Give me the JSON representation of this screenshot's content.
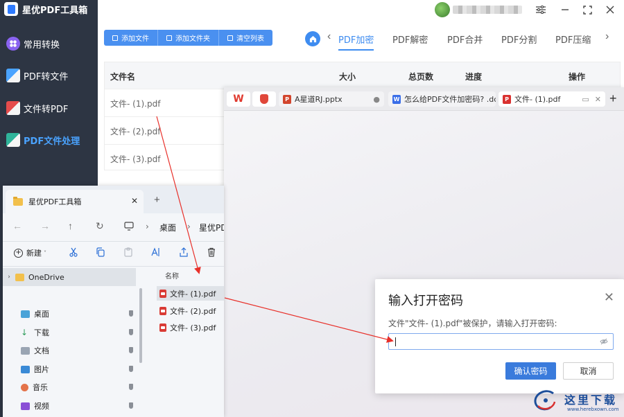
{
  "app": {
    "title": "星优PDF工具箱",
    "nav": [
      {
        "label": "常用转换"
      },
      {
        "label": "PDF转文件"
      },
      {
        "label": "文件转PDF"
      },
      {
        "label": "PDF文件处理"
      }
    ],
    "toolbar": {
      "add_file": "添加文件",
      "add_folder": "添加文件夹",
      "clear_list": "清空列表"
    },
    "func_tabs": [
      "PDF加密",
      "PDF解密",
      "PDF合并",
      "PDF分割",
      "PDF压缩"
    ],
    "table": {
      "headers": [
        "文件名",
        "大小",
        "总页数",
        "进度",
        "操作"
      ],
      "rows": [
        "文件- (1).pdf",
        "文件- (2).pdf",
        "文件- (3).pdf"
      ]
    }
  },
  "wps": {
    "tabs": [
      {
        "label": "A星道RJ.pptx",
        "icon": "ppt-file-icon"
      },
      {
        "label": "怎么给PDF文件加密码? .dc",
        "icon": "word-file-icon"
      },
      {
        "label": "文件- (1).pdf",
        "icon": "pdf-file-icon"
      }
    ]
  },
  "dialog": {
    "title": "输入打开密码",
    "message": "文件\"文件- (1).pdf\"被保护，请输入打开密码:",
    "confirm": "确认密码",
    "cancel": "取消",
    "password_value": ""
  },
  "explorer": {
    "tab_title": "星优PDF工具箱",
    "breadcrumb": [
      "桌面",
      "星优PD"
    ],
    "new_label": "新建",
    "tree": [
      {
        "label": "OneDrive",
        "icon": "folder-icon"
      },
      {
        "label": "桌面",
        "icon": "desktop-icon"
      },
      {
        "label": "下载",
        "icon": "download-icon"
      },
      {
        "label": "文档",
        "icon": "document-icon"
      },
      {
        "label": "图片",
        "icon": "picture-icon"
      },
      {
        "label": "音乐",
        "icon": "music-icon"
      },
      {
        "label": "视频",
        "icon": "video-icon"
      }
    ],
    "column_name": "名称",
    "files": [
      "文件- (1).pdf",
      "文件- (2).pdf",
      "文件- (3).pdf"
    ]
  },
  "watermark": {
    "text": "这里下载",
    "url": "www.herebxown.com"
  },
  "colors": {
    "sidebar_bg": "#2d3543",
    "accent_blue": "#3e8cf0",
    "active_nav": "#4aa3ff",
    "arrow_red": "#e8302a",
    "confirm_btn": "#3a7bdc"
  }
}
